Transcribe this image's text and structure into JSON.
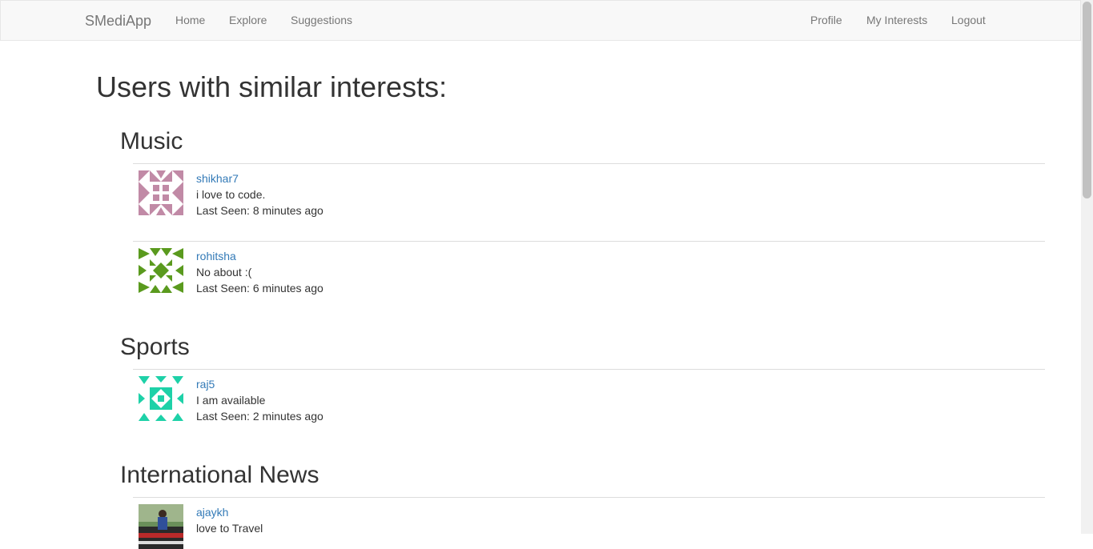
{
  "navbar": {
    "brand": "SMediApp",
    "left_links": [
      "Home",
      "Explore",
      "Suggestions"
    ],
    "right_links": [
      "Profile",
      "My Interests",
      "Logout"
    ]
  },
  "page_title": "Users with similar interests:",
  "sections": [
    {
      "title": "Music",
      "users": [
        {
          "name": "shikhar7",
          "about": "i love to code.",
          "last_seen": "Last Seen: 8 minutes ago",
          "avatar_color": "#c18aa6",
          "avatar_icon": "identicon-avatar"
        },
        {
          "name": "rohitsha",
          "about": "No about :(",
          "last_seen": "Last Seen: 6 minutes ago",
          "avatar_color": "#5a9a1e",
          "avatar_icon": "identicon-avatar"
        }
      ]
    },
    {
      "title": "Sports",
      "users": [
        {
          "name": "raj5",
          "about": "I am available",
          "last_seen": "Last Seen: 2 minutes ago",
          "avatar_color": "#1ed1a8",
          "avatar_icon": "identicon-avatar"
        }
      ]
    },
    {
      "title": "International News",
      "users": [
        {
          "name": "ajaykh",
          "about": "love to Travel",
          "last_seen": "",
          "avatar_color": "#3b5f7a",
          "avatar_icon": "photo-avatar"
        }
      ]
    }
  ]
}
